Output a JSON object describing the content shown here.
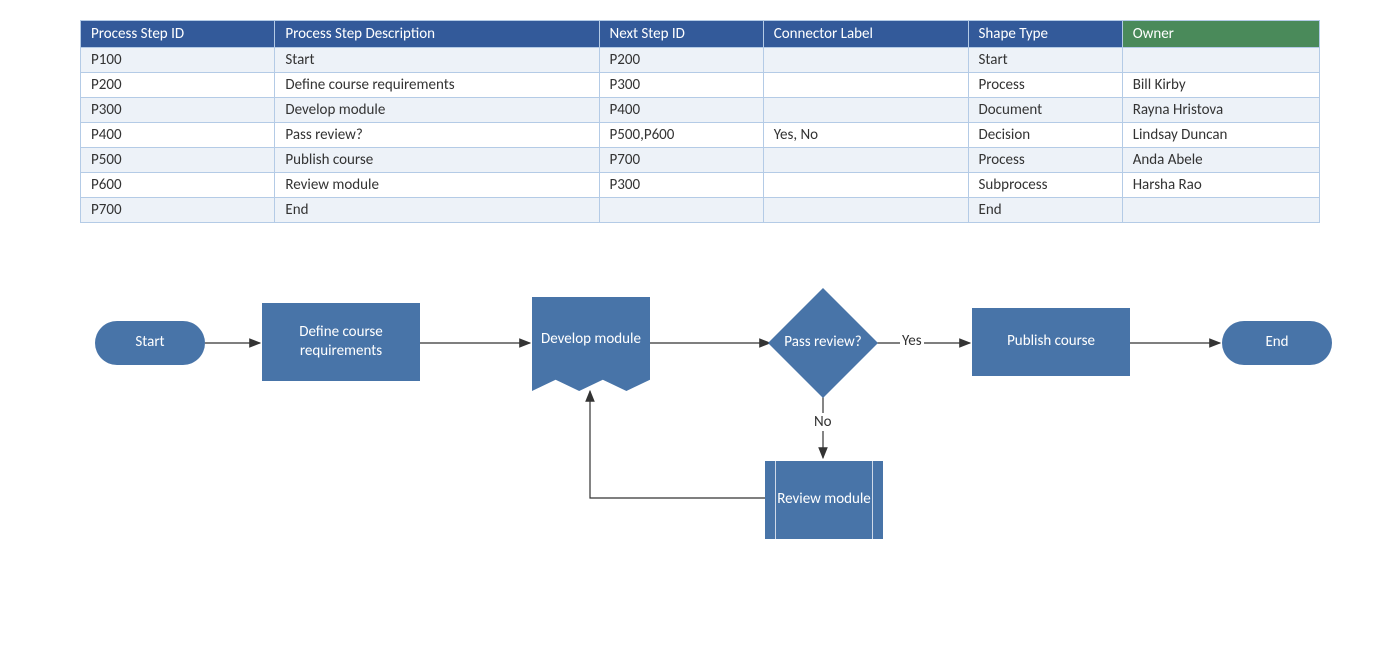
{
  "table": {
    "headers": [
      "Process Step ID",
      "Process Step Description",
      "Next Step ID",
      "Connector Label",
      "Shape Type",
      "Owner"
    ],
    "rows": [
      {
        "id": "P100",
        "desc": "Start",
        "next": "P200",
        "connector": "",
        "shape": "Start",
        "owner": ""
      },
      {
        "id": "P200",
        "desc": "Define course requirements",
        "next": "P300",
        "connector": "",
        "shape": "Process",
        "owner": "Bill Kirby"
      },
      {
        "id": "P300",
        "desc": "Develop module",
        "next": "P400",
        "connector": "",
        "shape": "Document",
        "owner": "Rayna Hristova"
      },
      {
        "id": "P400",
        "desc": "Pass review?",
        "next": "P500,P600",
        "connector": "Yes, No",
        "shape": "Decision",
        "owner": "Lindsay Duncan"
      },
      {
        "id": "P500",
        "desc": "Publish course",
        "next": "P700",
        "connector": "",
        "shape": "Process",
        "owner": "Anda Abele"
      },
      {
        "id": "P600",
        "desc": "Review module",
        "next": "P300",
        "connector": "",
        "shape": "Subprocess",
        "owner": "Harsha Rao"
      },
      {
        "id": "P700",
        "desc": "End",
        "next": "",
        "connector": "",
        "shape": "End",
        "owner": ""
      }
    ]
  },
  "flowchart": {
    "start": "Start",
    "defineCourse": "Define course requirements",
    "developModule": "Develop module",
    "passReview": "Pass review?",
    "publishCourse": "Publish course",
    "end": "End",
    "reviewModule": "Review module",
    "labelYes": "Yes",
    "labelNo": "No"
  }
}
